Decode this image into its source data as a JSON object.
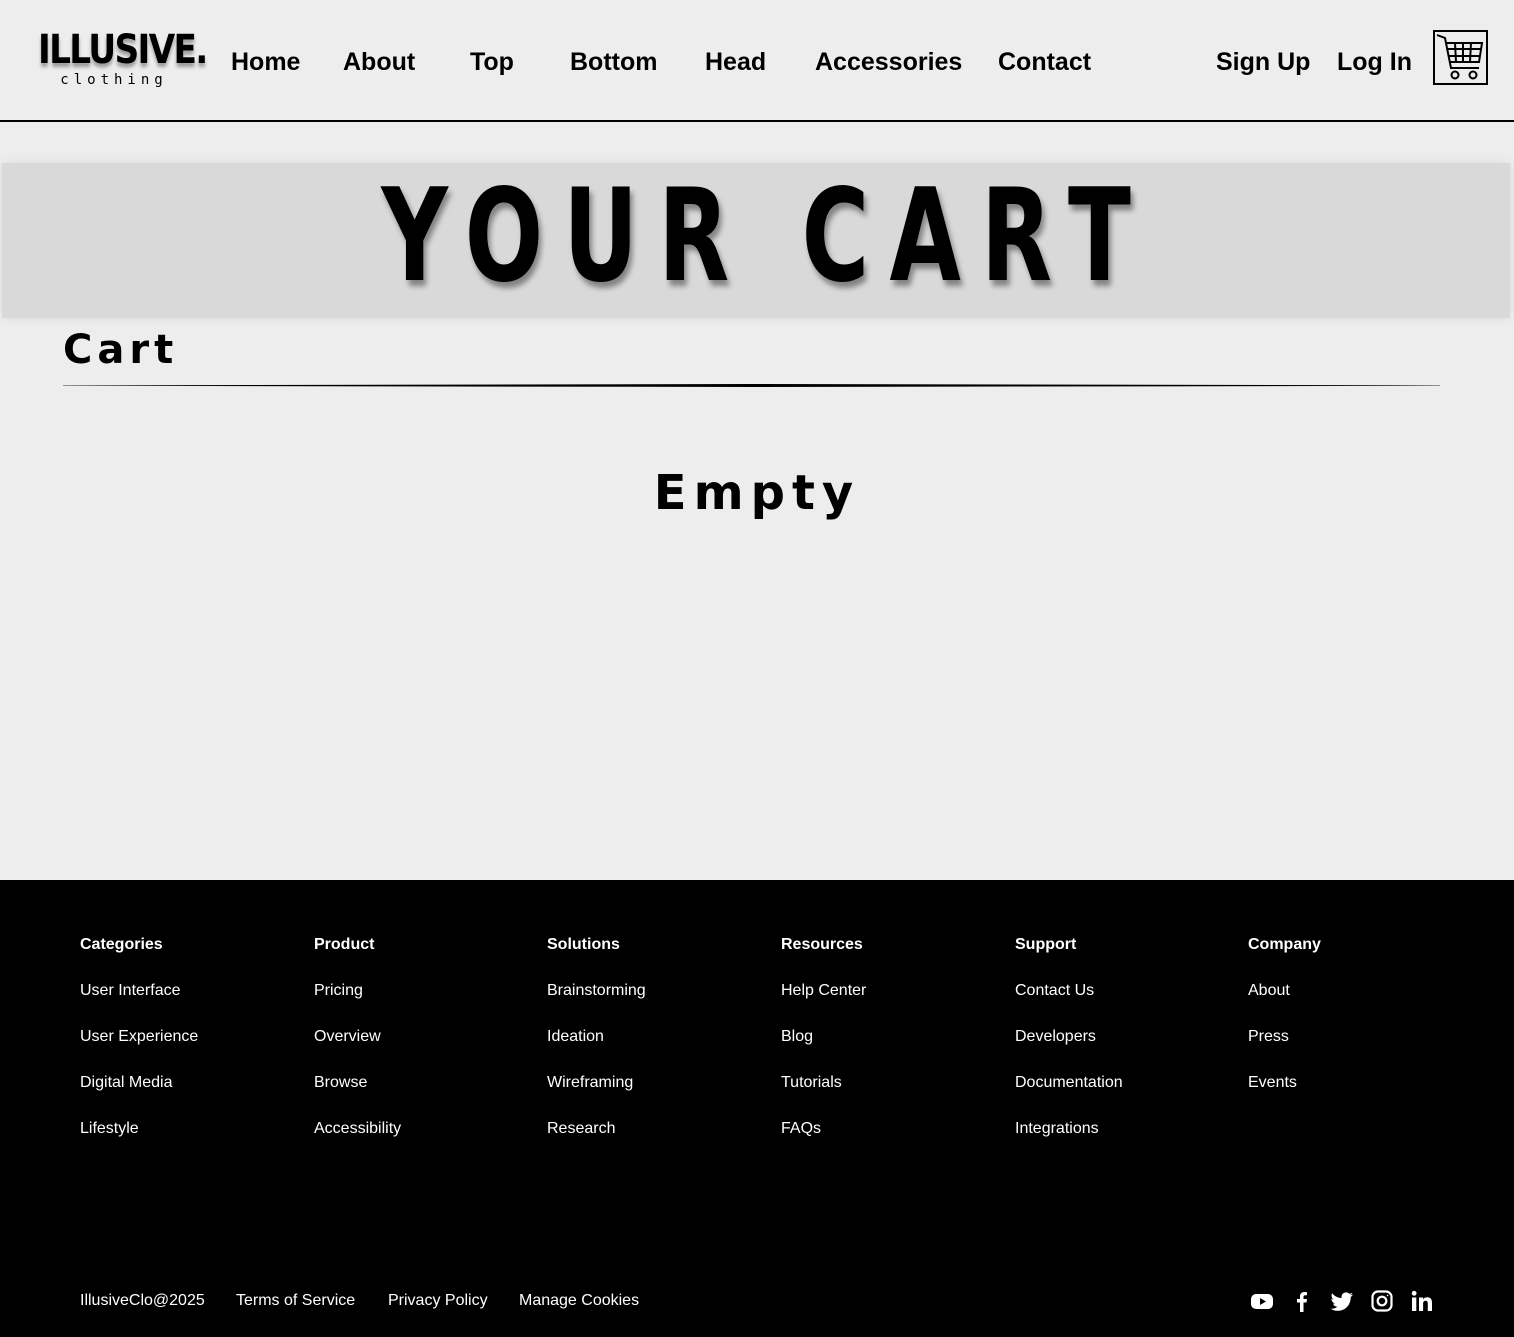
{
  "header": {
    "logo": {
      "main": "ILLUSIVE.",
      "sub": "clothing"
    },
    "nav": [
      "Home",
      "About",
      "Top",
      "Bottom",
      "Head",
      "Accessories",
      "Contact"
    ],
    "signup_label": "Sign Up",
    "login_label": "Log In",
    "cart_icon": "shopping-cart-icon"
  },
  "banner": {
    "title": "YOUR CART"
  },
  "cart": {
    "section_title": "Cart",
    "empty_label": "Empty"
  },
  "footer": {
    "columns": [
      {
        "heading": "Categories",
        "links": [
          "User Interface",
          "User Experience",
          "Digital Media",
          "Lifestyle"
        ]
      },
      {
        "heading": "Product",
        "links": [
          "Pricing",
          "Overview",
          "Browse",
          "Accessibility"
        ]
      },
      {
        "heading": "Solutions",
        "links": [
          "Brainstorming",
          "Ideation",
          "Wireframing",
          "Research"
        ]
      },
      {
        "heading": "Resources",
        "links": [
          "Help Center",
          "Blog",
          "Tutorials",
          "FAQs"
        ]
      },
      {
        "heading": "Support",
        "links": [
          "Contact Us",
          "Developers",
          "Documentation",
          "Integrations"
        ]
      },
      {
        "heading": "Company",
        "links": [
          "About",
          "Press",
          "Events"
        ]
      }
    ],
    "copyright": "IllusiveClo@2025",
    "legal": [
      "Terms of Service",
      "Privacy Policy",
      "Manage Cookies"
    ],
    "social_icons": [
      "youtube-icon",
      "facebook-icon",
      "twitter-icon",
      "instagram-icon",
      "linkedin-icon"
    ]
  },
  "colors": {
    "page_bg": "#ededed",
    "banner_bg": "#d9d9d9",
    "footer_bg": "#000000",
    "text": "#000000",
    "footer_text": "#ffffff"
  }
}
